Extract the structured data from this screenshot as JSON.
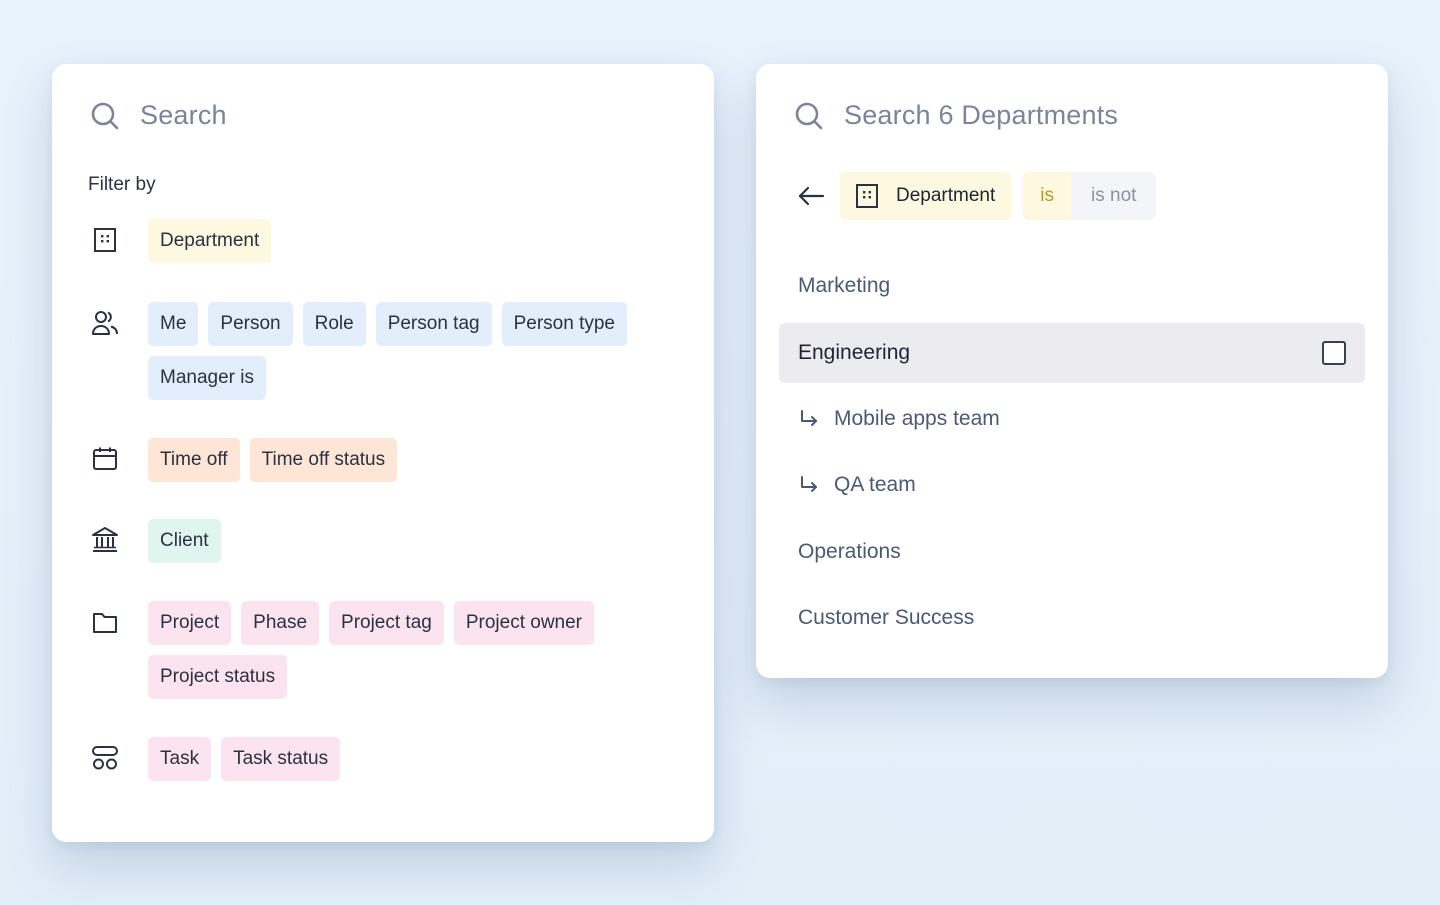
{
  "left_panel": {
    "search_placeholder": "Search",
    "filter_by_label": "Filter by",
    "groups": [
      {
        "icon": "building-icon",
        "chips": [
          "Department"
        ],
        "color": "#fdf8e0"
      },
      {
        "icon": "people-icon",
        "chips": [
          "Me",
          "Person",
          "Role",
          "Person tag",
          "Person type",
          "Manager is"
        ],
        "color": "#e2eefb"
      },
      {
        "icon": "calendar-icon",
        "chips": [
          "Time off",
          "Time off status"
        ],
        "color": "#fde6d6"
      },
      {
        "icon": "bank-icon",
        "chips": [
          "Client"
        ],
        "color": "#dff5ee"
      },
      {
        "icon": "folder-icon",
        "chips": [
          "Project",
          "Phase",
          "Project tag",
          "Project owner",
          "Project status"
        ],
        "color": "#fbe4ef"
      },
      {
        "icon": "task-layout-icon",
        "chips": [
          "Task",
          "Task status"
        ],
        "color": "#fbe4ef"
      }
    ]
  },
  "right_panel": {
    "search_placeholder": "Search 6 Departments",
    "filter_chip": "Department",
    "operator_is": "is",
    "operator_is_not": "is not",
    "options": [
      {
        "label": "Marketing",
        "child": false
      },
      {
        "label": "Engineering",
        "child": false,
        "highlighted": true,
        "checked": false
      },
      {
        "label": "Mobile apps team",
        "child": true
      },
      {
        "label": "QA team",
        "child": true
      },
      {
        "label": "Operations",
        "child": false
      },
      {
        "label": "Customer Success",
        "child": false
      }
    ]
  },
  "colors": {
    "background": "#e6f0fa",
    "chip_yellow": "#fdf8e0",
    "chip_blue": "#e2eefb",
    "chip_orange": "#fde6d6",
    "chip_teal": "#dff5ee",
    "chip_pink": "#fbe4ef",
    "highlight_row": "#ebebf0"
  }
}
